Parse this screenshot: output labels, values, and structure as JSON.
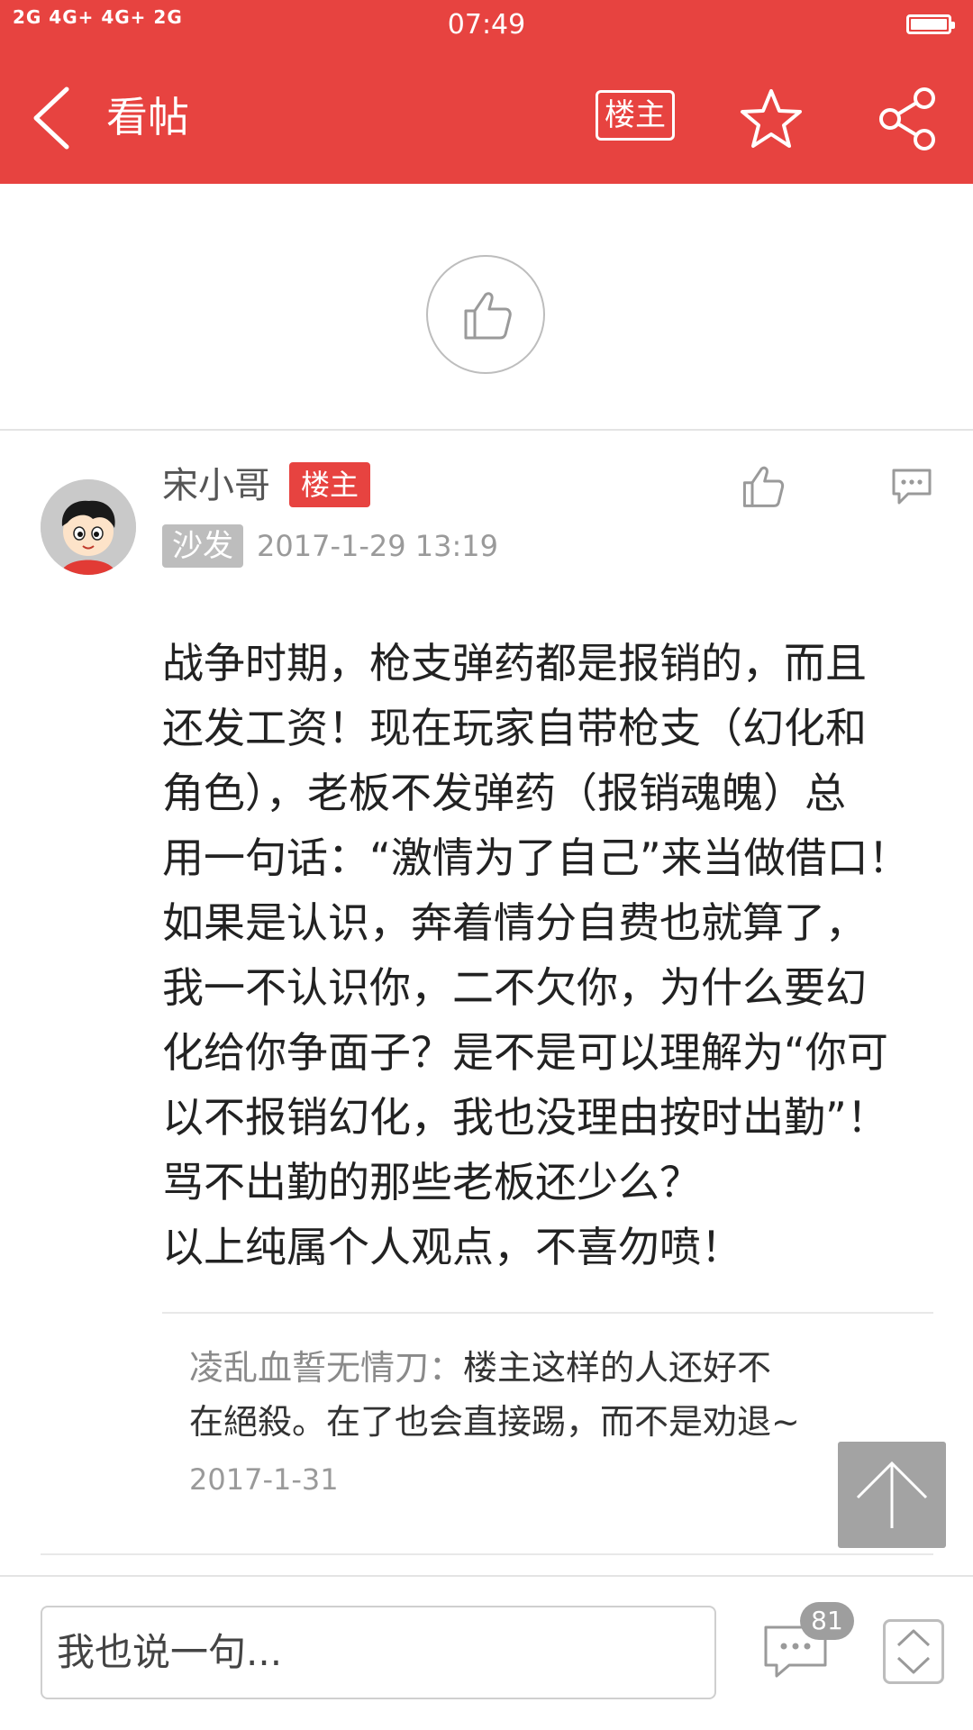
{
  "status_bar": {
    "signal_text": "2G 4G+ 4G+ 2G",
    "time": "07:49"
  },
  "header": {
    "title": "看帖",
    "op_filter_label": "楼主"
  },
  "post": {
    "username": "宋小哥",
    "op_badge": "楼主",
    "floor_badge": "沙发",
    "time": "2017-1-29 13:19",
    "lines": [
      "战争时期，枪支弹药都是报销的，而且",
      "还发工资！现在玩家自带枪支（幻化和",
      "角色），老板不发弹药（报销魂魄）总",
      "用一句话：“激情为了自己”来当做借口！",
      "如果是认识，奔着情分自费也就算了，",
      "我一不认识你，二不欠你，为什么要幻",
      "化给你争面子？是不是可以理解为“你可",
      "以不报销幻化，我也没理由按时出勤”！",
      "骂不出勤的那些老板还少么？",
      "以上纯属个人观点，不喜勿喷！"
    ],
    "reply": {
      "author": "凌乱血誓无情刀：",
      "line1": "楼主这样的人还好不",
      "line2": "在絕殺。在了也会直接踢，而不是劝退~",
      "date": "2017-1-31"
    }
  },
  "bottom_bar": {
    "input_placeholder": "我也说一句...",
    "comment_count": "81"
  },
  "colors": {
    "brand": "#e74340",
    "badge_gray": "#bdbdbd"
  },
  "icons": [
    "back-arrow-icon",
    "star-icon",
    "share-icon",
    "thumbs-up-icon",
    "comment-icon",
    "arrow-up-icon",
    "up-down-icon"
  ]
}
